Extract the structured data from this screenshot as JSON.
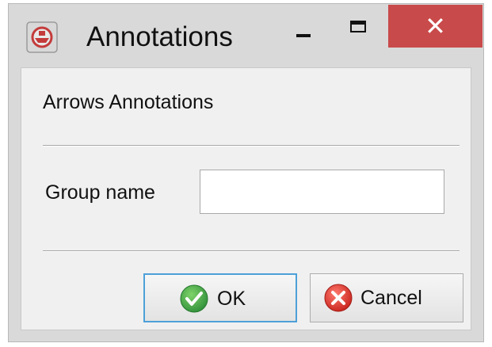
{
  "window": {
    "title": "Annotations",
    "close_glyph": "✕",
    "app_icon": "app-icon",
    "colors": {
      "close_button": "#c94a4a",
      "frame": "#d9d9d9",
      "content_background": "#f0f0f0",
      "ok_focus_border": "#4da0d8"
    }
  },
  "dialog": {
    "section_title": "Arrows Annotations",
    "group_name": {
      "label": "Group name",
      "value": "",
      "placeholder": ""
    },
    "buttons": {
      "ok": {
        "label": "OK",
        "icon": "check-icon",
        "color": "#3aa844"
      },
      "cancel": {
        "label": "Cancel",
        "icon": "cancel-x-icon",
        "color": "#d9322b"
      }
    }
  }
}
